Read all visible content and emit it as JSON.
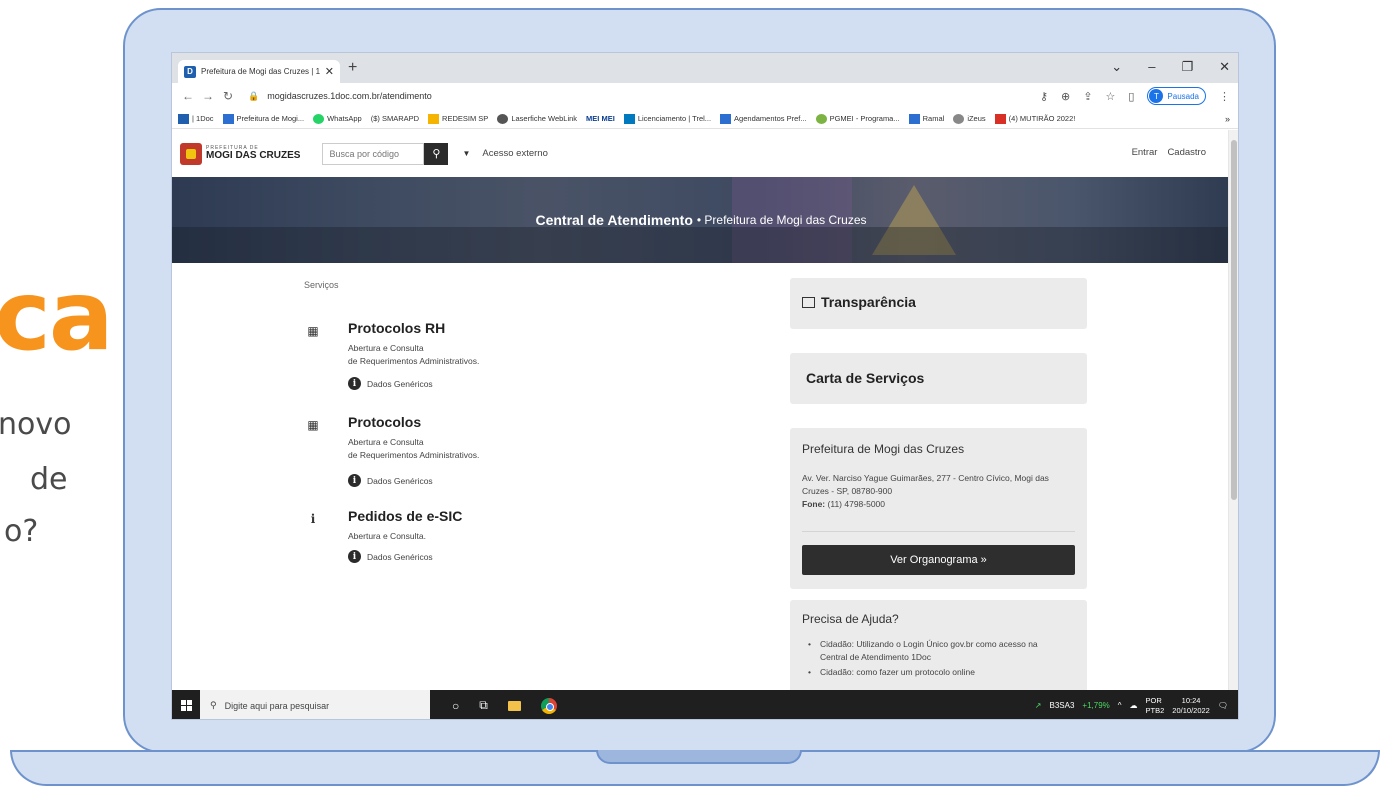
{
  "slide": {
    "big_text": "ca",
    "line1": "novo",
    "line2": "de",
    "line3": "o?"
  },
  "browser": {
    "tab_title": "Prefeitura de Mogi das Cruzes | 1",
    "tab_favicon": "D",
    "new_tab": "+",
    "url": "mogidascruzes.1doc.com.br/atendimento",
    "profile_initial": "T",
    "profile_status": "Pausada",
    "bookmarks": [
      {
        "label": "| 1Doc",
        "icon": "1doc-icon",
        "color": "#1f5fae"
      },
      {
        "label": "Prefeitura de Mogi...",
        "icon": "prefeitura-icon",
        "color": "#2c6fd1"
      },
      {
        "label": "WhatsApp",
        "icon": "whatsapp-icon",
        "color": "#25d366"
      },
      {
        "label": "($) SMARAPD",
        "icon": "smarapd-icon",
        "color": "#1a73e8"
      },
      {
        "label": "REDESIM SP",
        "icon": "redesim-icon",
        "color": "#f4b400"
      },
      {
        "label": "Laserfiche WebLink",
        "icon": "globe-icon",
        "color": "#555555"
      },
      {
        "label": "MEI MEI",
        "icon": "mei-icon",
        "color": "#0b3d91"
      },
      {
        "label": "Licenciamento | Trel...",
        "icon": "trello-icon",
        "color": "#0079bf"
      },
      {
        "label": "Agendamentos Pref...",
        "icon": "prefeitura-icon",
        "color": "#2c6fd1"
      },
      {
        "label": "PGMEI - Programa...",
        "icon": "pgmei-icon",
        "color": "#7cb342"
      },
      {
        "label": "Ramal",
        "icon": "prefeitura-icon",
        "color": "#2c6fd1"
      },
      {
        "label": "iZeus",
        "icon": "izeus-icon",
        "color": "#888888"
      },
      {
        "label": "(4) MUTIRÃO 2022!",
        "icon": "mutirao-icon",
        "color": "#d93025"
      }
    ],
    "bookmarks_more": "»"
  },
  "site": {
    "logo_small": "PREFEITURA DE",
    "logo_main": "MOGI DAS CRUZES",
    "search_placeholder": "Busca por código",
    "external_access": "Acesso externo",
    "login": "Entrar",
    "register": "Cadastro",
    "banner_strong": "Central de Atendimento",
    "banner_rest": "• Prefeitura de Mogi das Cruzes",
    "services_label": "Serviços",
    "services": [
      {
        "title": "Protocolos RH",
        "desc1": "Abertura e Consulta",
        "desc2": "de Requerimentos Administrativos.",
        "link": "Dados Genéricos",
        "icon": "qr-code-icon"
      },
      {
        "title": "Protocolos",
        "desc1": "Abertura e Consulta",
        "desc2": "de Requerimentos Administrativos.",
        "link": "Dados Genéricos",
        "icon": "qr-code-icon"
      },
      {
        "title": "Pedidos de e-SIC",
        "desc1": "Abertura e Consulta.",
        "desc2": "",
        "link": "Dados Genéricos",
        "icon": "info-icon"
      }
    ],
    "transparency": "Transparência",
    "service_letter": "Carta de Serviços",
    "contact": {
      "title": "Prefeitura de Mogi das Cruzes",
      "address1": "Av. Ver. Narciso Yague Guimarães, 277 - Centro Cívico, Mogi das",
      "address2": "Cruzes - SP, 08780-900",
      "phone_label": "Fone:",
      "phone": "(11) 4798-5000",
      "org_button": "Ver Organograma »"
    },
    "help": {
      "title": "Precisa de Ajuda?",
      "items": [
        "Cidadão: Utilizando o Login Único gov.br como acesso na",
        "Central de Atendimento 1Doc",
        "Cidadão: como fazer um protocolo online"
      ]
    }
  },
  "taskbar": {
    "search_placeholder": "Digite aqui para pesquisar",
    "stock": "B3SA3",
    "stock_change": "+1,79%",
    "lang1": "POR",
    "lang2": "PTB2",
    "time": "10:24",
    "date": "20/10/2022"
  }
}
